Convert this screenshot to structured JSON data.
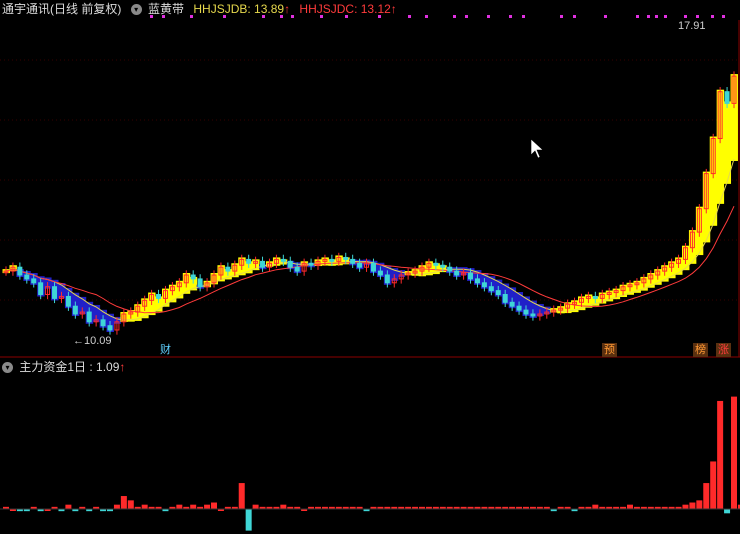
{
  "header": {
    "stock_title": "通宇通讯(日线 前复权)",
    "indicator_name": "蓝黄带",
    "line1_label": "HHJSJDB: 13.89",
    "line2_label": "HHJSJDC: 13.12",
    "arrow": "↑",
    "line1_color": "#e6d84c",
    "line2_color": "#ff3b3b"
  },
  "price_panel": {
    "high_marker": "17.91",
    "low_marker": "10.09",
    "badges": [
      {
        "text": "财",
        "color": "#5fd0ff"
      },
      {
        "text": "预",
        "color": "#ff9933"
      },
      {
        "text": "榜",
        "color": "#ff9933"
      },
      {
        "text": "涨",
        "color": "#ff3b3b"
      }
    ]
  },
  "sub_panel": {
    "title": "主力资金1日",
    "value": ": 1.09",
    "arrow": "↑"
  },
  "colors": {
    "up": "#ff2a2a",
    "down": "#3fd6d6",
    "ribbon_up": "#ffff00",
    "ribbon_down": "#2020c8",
    "magenta": "#e030e0"
  },
  "chart_data": {
    "type": "candlestick",
    "y_range": [
      10.09,
      17.91
    ],
    "closes": [
      11.6,
      11.7,
      11.5,
      11.4,
      11.3,
      11.0,
      11.2,
      10.9,
      10.95,
      10.7,
      10.5,
      10.55,
      10.3,
      10.35,
      10.2,
      10.09,
      10.3,
      10.5,
      10.55,
      10.7,
      10.85,
      11.0,
      10.9,
      11.1,
      11.2,
      11.3,
      11.5,
      11.4,
      11.2,
      11.3,
      11.5,
      11.7,
      11.6,
      11.75,
      11.9,
      11.8,
      11.85,
      11.7,
      11.8,
      11.9,
      11.85,
      11.7,
      11.6,
      11.8,
      11.75,
      11.85,
      11.9,
      11.85,
      11.95,
      11.9,
      11.8,
      11.7,
      11.8,
      11.6,
      11.5,
      11.3,
      11.4,
      11.5,
      11.55,
      11.6,
      11.7,
      11.8,
      11.75,
      11.7,
      11.6,
      11.5,
      11.55,
      11.4,
      11.3,
      11.2,
      11.1,
      11.0,
      10.8,
      10.7,
      10.6,
      10.5,
      10.45,
      10.5,
      10.55,
      10.6,
      10.65,
      10.75,
      10.8,
      10.9,
      10.95,
      10.9,
      11.0,
      11.05,
      11.1,
      11.2,
      11.25,
      11.3,
      11.4,
      11.5,
      11.6,
      11.7,
      11.8,
      11.9,
      12.2,
      12.6,
      13.2,
      14.1,
      15.0,
      16.2,
      15.9,
      16.6
    ],
    "fund_flow": [
      0.05,
      0.0,
      -0.05,
      -0.05,
      0.05,
      -0.05,
      0.0,
      0.05,
      -0.05,
      0.1,
      -0.05,
      0.05,
      -0.05,
      0.05,
      -0.05,
      -0.05,
      0.1,
      0.3,
      0.2,
      0.05,
      0.1,
      0.05,
      0.05,
      -0.05,
      0.05,
      0.1,
      0.05,
      0.1,
      0.05,
      0.1,
      0.15,
      0.0,
      0.05,
      0.05,
      0.6,
      -0.5,
      0.1,
      0.05,
      0.05,
      0.05,
      0.1,
      0.05,
      0.05,
      0.0,
      0.05,
      0.05,
      0.05,
      0.05,
      0.05,
      0.05,
      0.05,
      0.05,
      -0.05,
      0.05,
      0.05,
      0.05,
      0.05,
      0.05,
      0.05,
      0.05,
      0.05,
      0.05,
      0.05,
      0.05,
      0.05,
      0.05,
      0.05,
      0.05,
      0.05,
      0.05,
      0.05,
      0.05,
      0.05,
      0.05,
      0.05,
      0.05,
      0.05,
      0.05,
      0.05,
      -0.05,
      0.05,
      0.05,
      -0.05,
      0.05,
      0.05,
      0.1,
      0.05,
      0.05,
      0.05,
      0.05,
      0.1,
      0.05,
      0.05,
      0.05,
      0.05,
      0.05,
      0.05,
      0.05,
      0.1,
      0.15,
      0.2,
      0.6,
      1.1,
      2.5,
      -0.1,
      2.6,
      0.1,
      0.3,
      3.1
    ]
  }
}
